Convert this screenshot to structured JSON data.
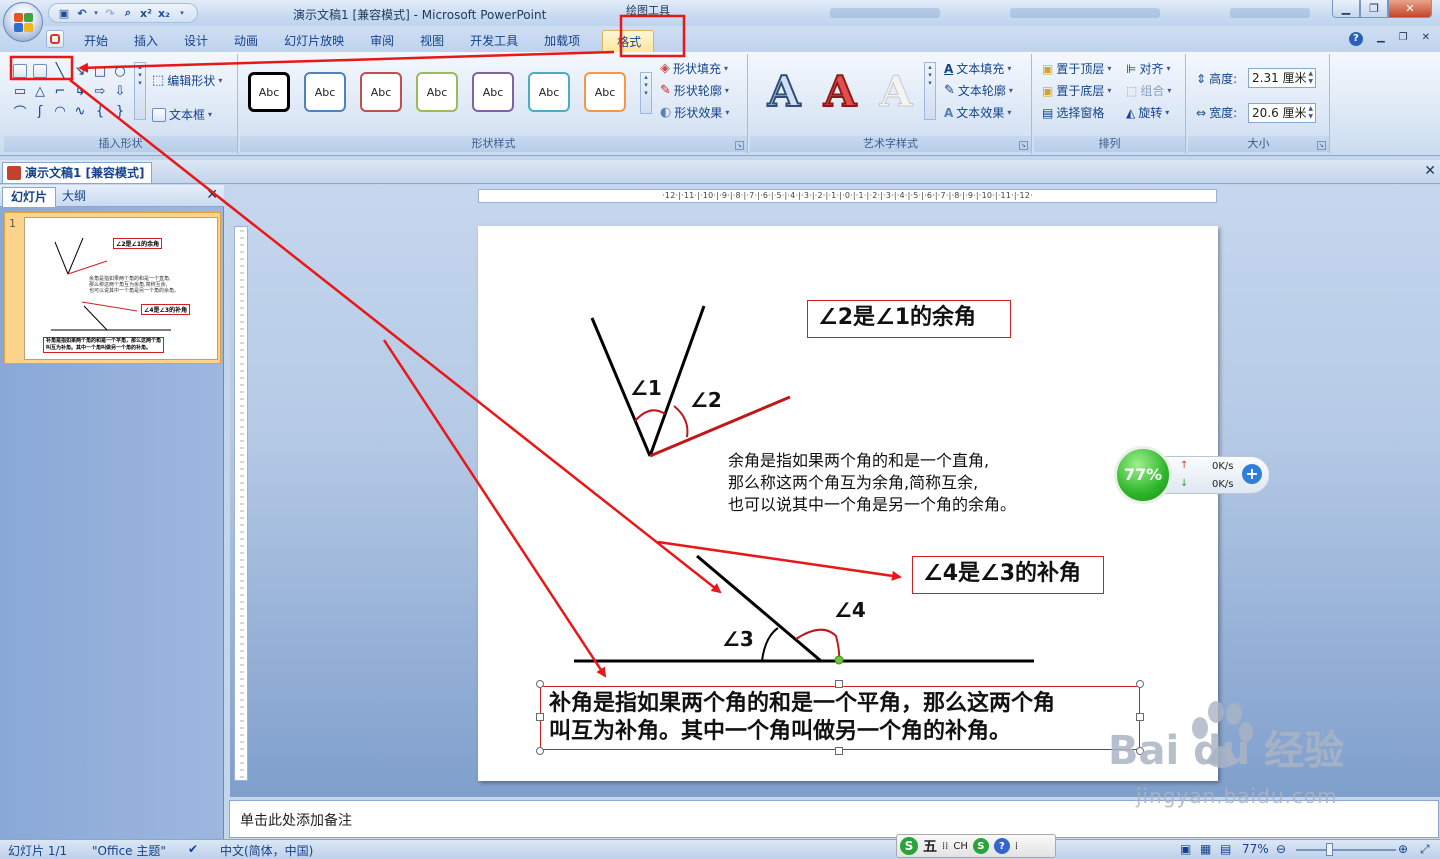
{
  "window": {
    "title": "演示文稿1 [兼容模式] - Microsoft PowerPoint",
    "context_tab_title": "绘图工具"
  },
  "tabs": [
    {
      "label": "开始"
    },
    {
      "label": "插入"
    },
    {
      "label": "设计"
    },
    {
      "label": "动画"
    },
    {
      "label": "幻灯片放映"
    },
    {
      "label": "审阅"
    },
    {
      "label": "视图"
    },
    {
      "label": "开发工具"
    },
    {
      "label": "加载项"
    },
    {
      "label": "格式"
    }
  ],
  "ribbon": {
    "insert_shapes": {
      "label": "插入形状",
      "edit_shape": "编辑形状",
      "text_box": "文本框"
    },
    "shape_styles": {
      "label": "形状样式",
      "sample": "Abc",
      "fill": "形状填充",
      "outline": "形状轮廓",
      "effects": "形状效果",
      "style_colors": [
        "#000000",
        "#4f81bd",
        "#c0504d",
        "#9bbb59",
        "#8064a2",
        "#4bacc6",
        "#f79646"
      ]
    },
    "wordart": {
      "label": "艺术字样式",
      "letter": "A",
      "text_fill": "文本填充",
      "text_outline": "文本轮廓",
      "text_effects": "文本效果"
    },
    "arrange": {
      "label": "排列",
      "bring_front": "置于顶层",
      "send_back": "置于底层",
      "selection_pane": "选择窗格",
      "align": "对齐",
      "group": "组合",
      "rotate": "旋转"
    },
    "size": {
      "label": "大小",
      "height_label": "高度:",
      "height_value": "2.31 厘米",
      "width_label": "宽度:",
      "width_value": "20.6 厘米"
    }
  },
  "document_tab": "演示文稿1 [兼容模式]",
  "left_pane": {
    "tab_slides": "幻灯片",
    "tab_outline": "大纲",
    "slide_number": "1"
  },
  "ruler": {
    "horizontal": "·12·|·11·|·10·|·9·|·8·|·7·|·6·|·5·|·4·|·3·|·2·|·1·|·0·|·1·|·2·|·3·|·4·|·5·|·6·|·7·|·8·|·9·|·10·|·11·|·12·"
  },
  "slide": {
    "box_complementary": "∠2是∠1的余角",
    "label_angle1": "∠1",
    "label_angle2": "∠2",
    "def_complementary": [
      "余角是指如果两个角的和是一个直角,",
      "那么称这两个角互为余角,简称互余,",
      "也可以说其中一个角是另一个角的余角。"
    ],
    "box_supplementary": "∠4是∠3的补角",
    "label_angle3": "∠3",
    "label_angle4": "∠4",
    "def_supplementary": [
      "补角是指如果两个角的和是一个平角，那么这两个角",
      "叫互为补角。其中一个角叫做另一个角的补角。"
    ]
  },
  "speed_widget": {
    "percent": "77%",
    "up": "0K/s",
    "down": "0K/s",
    "plus": "+"
  },
  "notes_placeholder": "单击此处添加备注",
  "watermark": {
    "main": "Bai du 经验",
    "sub": "jingyan.baidu.com"
  },
  "ime": {
    "wubi": "五",
    "lang": "CH",
    "help": "?"
  },
  "status": {
    "slide_counter": "幻灯片 1/1",
    "theme": "\"Office 主题\"",
    "language": "中文(简体，中国)",
    "zoom": "77%"
  },
  "colors": {
    "annotation_red": "#e81818",
    "ribbon_blue": "#15428b",
    "active_tab": "#ffe69b"
  }
}
